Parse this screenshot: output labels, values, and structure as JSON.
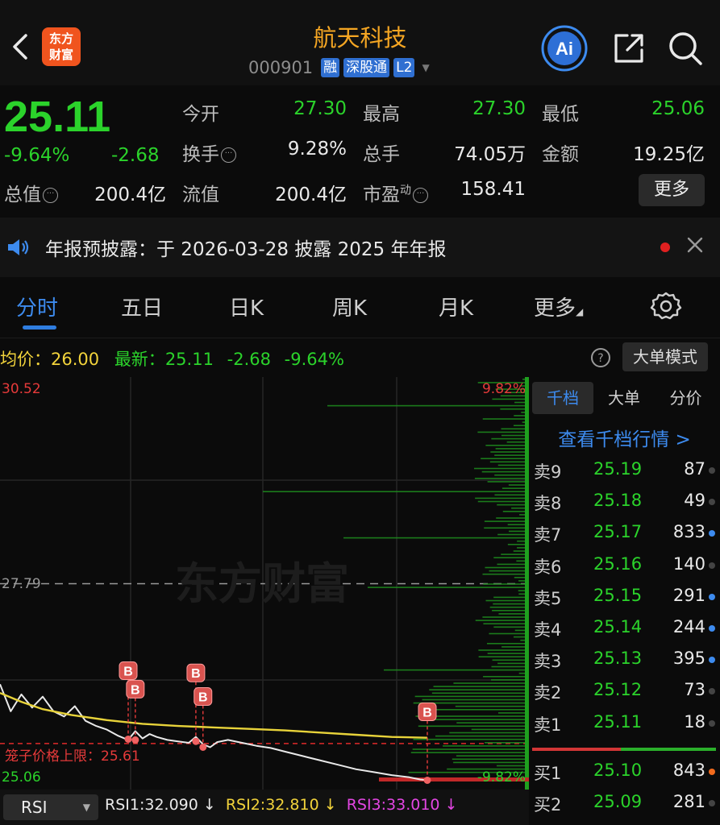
{
  "header": {
    "logo_line1": "东方",
    "logo_line2": "财富",
    "stock_name": "航天科技",
    "stock_code": "000901",
    "tags": [
      "融",
      "深股通",
      "L2"
    ],
    "ai_label": "Ai"
  },
  "quote": {
    "price": "25.11",
    "change_pct": "-9.64%",
    "change": "-2.68",
    "stats": {
      "open_label": "今开",
      "open": "27.30",
      "high_label": "最高",
      "high": "27.30",
      "low_label": "最低",
      "low": "25.06",
      "turnover_label": "换手",
      "turnover": "9.28%",
      "volume_label": "总手",
      "volume": "74.05万",
      "amount_label": "金额",
      "amount": "19.25亿",
      "mcap_label": "总值",
      "mcap": "200.4亿",
      "float_label": "流值",
      "float": "200.4亿",
      "pe_label": "市盈",
      "pe_sup": "动",
      "pe": "158.41"
    },
    "more_label": "更多"
  },
  "notice": {
    "text": "年报预披露：于 2026-03-28 披露 2025 年年报"
  },
  "tabs": {
    "items": [
      "分时",
      "五日",
      "日K",
      "周K",
      "月K",
      "更多"
    ],
    "active": 0
  },
  "status": {
    "avg_label": "均价：",
    "avg_value": "26.00",
    "latest_label": "最新：",
    "latest_price": "25.11",
    "latest_change": "-2.68",
    "latest_pct": "-9.64%",
    "bigorder_label": "大单模式"
  },
  "chart_data": {
    "type": "line",
    "ylim": [
      25.06,
      30.52
    ],
    "y_top_label": "30.52",
    "y_mid_label": "27.79",
    "y_bottom_label": "25.06",
    "pct_top_label": "9.82%",
    "pct_bottom_label": "-9.82%",
    "prev_close": 27.79,
    "watermark": "东方财富",
    "cage_label": "笼子价格上限：25.61",
    "cage_price": 25.61,
    "series": [
      {
        "color": "#e9e9e9",
        "points": [
          [
            0,
            26.42
          ],
          [
            3,
            26.05
          ],
          [
            6,
            26.28
          ],
          [
            9,
            26.1
          ],
          [
            12,
            26.25
          ],
          [
            15,
            26.05
          ],
          [
            18,
            25.98
          ],
          [
            21,
            26.12
          ],
          [
            24,
            25.92
          ],
          [
            27,
            25.85
          ],
          [
            30,
            25.8
          ],
          [
            33,
            25.72
          ],
          [
            36,
            25.66
          ],
          [
            38,
            25.78
          ],
          [
            40,
            25.68
          ],
          [
            42,
            25.74
          ],
          [
            44,
            25.7
          ],
          [
            47,
            25.66
          ],
          [
            50,
            25.64
          ],
          [
            53,
            25.62
          ],
          [
            55,
            25.7
          ],
          [
            57,
            25.6
          ],
          [
            59,
            25.56
          ],
          [
            61,
            25.63
          ],
          [
            64,
            25.66
          ],
          [
            68,
            25.62
          ],
          [
            72,
            25.58
          ],
          [
            76,
            25.55
          ],
          [
            80,
            25.5
          ],
          [
            85,
            25.44
          ],
          [
            90,
            25.38
          ],
          [
            95,
            25.32
          ],
          [
            100,
            25.26
          ],
          [
            105,
            25.22
          ],
          [
            110,
            25.18
          ],
          [
            115,
            25.15
          ],
          [
            118,
            25.12
          ],
          [
            120,
            25.11
          ]
        ]
      },
      {
        "color": "#e8d33a",
        "points": [
          [
            0,
            26.3
          ],
          [
            6,
            26.18
          ],
          [
            12,
            26.08
          ],
          [
            20,
            26.0
          ],
          [
            30,
            25.93
          ],
          [
            40,
            25.88
          ],
          [
            50,
            25.85
          ],
          [
            60,
            25.83
          ],
          [
            70,
            25.81
          ],
          [
            80,
            25.79
          ],
          [
            90,
            25.76
          ],
          [
            100,
            25.73
          ],
          [
            110,
            25.7
          ],
          [
            120,
            25.69
          ]
        ]
      }
    ],
    "markers": [
      {
        "x": 36,
        "y": 25.67,
        "label": "B"
      },
      {
        "x": 38,
        "y": 25.66,
        "label": "B"
      },
      {
        "x": 55,
        "y": 25.64,
        "label": "B"
      },
      {
        "x": 57,
        "y": 25.56,
        "label": "B"
      },
      {
        "x": 120,
        "y": 25.11,
        "label": "B"
      }
    ],
    "x_range": [
      0,
      120
    ]
  },
  "book": {
    "tabs": [
      "千档",
      "大单",
      "分价"
    ],
    "active_tab": 0,
    "link": "查看千档行情 >",
    "sell": [
      {
        "label": "卖9",
        "price": "25.19",
        "volume": "87",
        "dot": "#444"
      },
      {
        "label": "卖8",
        "price": "25.18",
        "volume": "49",
        "dot": "#444"
      },
      {
        "label": "卖7",
        "price": "25.17",
        "volume": "833",
        "dot": "#3d8bef"
      },
      {
        "label": "卖6",
        "price": "25.16",
        "volume": "140",
        "dot": "#444"
      },
      {
        "label": "卖5",
        "price": "25.15",
        "volume": "291",
        "dot": "#3d8bef"
      },
      {
        "label": "卖4",
        "price": "25.14",
        "volume": "244",
        "dot": "#3d8bef"
      },
      {
        "label": "卖3",
        "price": "25.13",
        "volume": "395",
        "dot": "#3d8bef"
      },
      {
        "label": "卖2",
        "price": "25.12",
        "volume": "73",
        "dot": "#444"
      },
      {
        "label": "卖1",
        "price": "25.11",
        "volume": "18",
        "dot": "#444"
      }
    ],
    "buy": [
      {
        "label": "买1",
        "price": "25.10",
        "volume": "843",
        "dot": "#f26b1d"
      },
      {
        "label": "买2",
        "price": "25.09",
        "volume": "281",
        "dot": "#444"
      }
    ]
  },
  "indicator": {
    "selected": "RSI",
    "rsi1": "RSI1:32.090 ↓",
    "rsi2": "RSI2:32.810 ↓",
    "rsi3": "RSI3:33.010 ↓"
  }
}
